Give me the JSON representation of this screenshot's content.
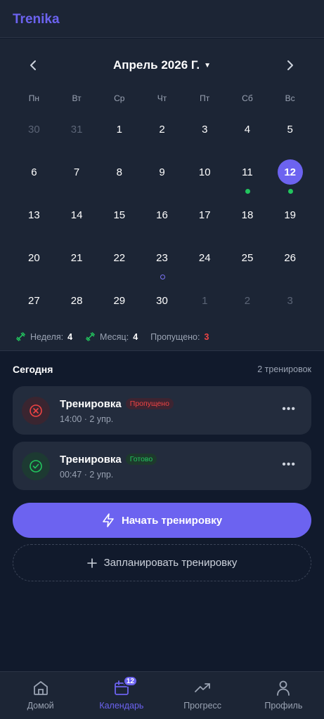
{
  "app": {
    "brand": "Trenika"
  },
  "calendar": {
    "month_title": "Апрель 2026 Г.",
    "weekdays": [
      "Пн",
      "Вт",
      "Ср",
      "Чт",
      "Пт",
      "Сб",
      "Вс"
    ],
    "weeks": [
      [
        {
          "d": "30",
          "muted": true
        },
        {
          "d": "31",
          "muted": true
        },
        {
          "d": "1"
        },
        {
          "d": "2"
        },
        {
          "d": "3"
        },
        {
          "d": "4"
        },
        {
          "d": "5"
        }
      ],
      [
        {
          "d": "6"
        },
        {
          "d": "7"
        },
        {
          "d": "8"
        },
        {
          "d": "9"
        },
        {
          "d": "10"
        },
        {
          "d": "11",
          "marker": "done"
        },
        {
          "d": "12",
          "today": true,
          "marker": "done"
        }
      ],
      [
        {
          "d": "13"
        },
        {
          "d": "14"
        },
        {
          "d": "15"
        },
        {
          "d": "16"
        },
        {
          "d": "17"
        },
        {
          "d": "18"
        },
        {
          "d": "19"
        }
      ],
      [
        {
          "d": "20"
        },
        {
          "d": "21"
        },
        {
          "d": "22"
        },
        {
          "d": "23",
          "marker": "planned"
        },
        {
          "d": "24"
        },
        {
          "d": "25"
        },
        {
          "d": "26"
        }
      ],
      [
        {
          "d": "27"
        },
        {
          "d": "28"
        },
        {
          "d": "29"
        },
        {
          "d": "30"
        },
        {
          "d": "1",
          "muted": true
        },
        {
          "d": "2",
          "muted": true
        },
        {
          "d": "3",
          "muted": true
        }
      ]
    ],
    "stats": {
      "week_label": "Неделя:",
      "week_value": "4",
      "month_label": "Месяц:",
      "month_value": "4",
      "missed_label": "Пропущено:",
      "missed_value": "3"
    }
  },
  "today": {
    "title": "Сегодня",
    "count": "2 тренировок",
    "workouts": [
      {
        "title": "Тренировка",
        "status": "Пропущено",
        "time": "14:00",
        "exercises": "2 упр.",
        "state": "missed"
      },
      {
        "title": "Тренировка",
        "status": "Готово",
        "time": "00:47",
        "exercises": "2 упр.",
        "state": "done"
      }
    ]
  },
  "actions": {
    "start_label": "Начать тренировку",
    "plan_label": "Запланировать тренировку"
  },
  "tabbar": {
    "items": [
      {
        "label": "Домой",
        "icon": "home-icon"
      },
      {
        "label": "Календарь",
        "icon": "calendar-icon",
        "badge": "12",
        "active": true
      },
      {
        "label": "Прогресс",
        "icon": "trending-up-icon"
      },
      {
        "label": "Профиль",
        "icon": "user-icon"
      }
    ]
  },
  "colors": {
    "accent": "#6c63f0",
    "success": "#22c55e",
    "danger": "#ef4444"
  }
}
